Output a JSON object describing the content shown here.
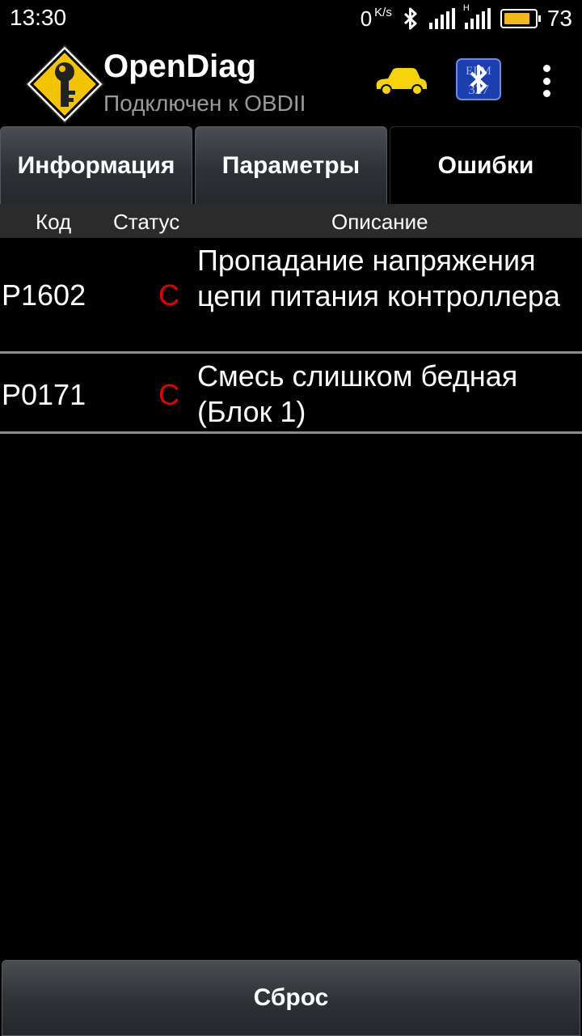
{
  "status_bar": {
    "time": "13:30",
    "net_speed_value": "0",
    "net_speed_unit": "K/s",
    "network_type_label": "H",
    "battery_percent": "73",
    "battery_level": 0.73,
    "battery_color": "#f3b81a"
  },
  "app": {
    "title": "OpenDiag",
    "subtitle": "Подключен к OBDII",
    "icons": [
      "key-icon",
      "car-icon",
      "bluetooth-adapter-icon",
      "overflow-menu-icon"
    ],
    "adapter_icon_text": "ELM 327"
  },
  "tabs": [
    {
      "label": "Информация",
      "active": false
    },
    {
      "label": "Параметры",
      "active": false
    },
    {
      "label": "Ошибки",
      "active": true
    }
  ],
  "table": {
    "headers": {
      "code": "Код",
      "status": "Статус",
      "description": "Описание"
    },
    "rows": [
      {
        "code": "P1602",
        "status": "C",
        "description": "Пропадание напряжения цепи питания контроллера"
      },
      {
        "code": "P0171",
        "status": "C",
        "description": "Смесь слишком бедная (Блок 1)"
      }
    ],
    "status_color": "#e00000"
  },
  "reset_button": {
    "label": "Сброс"
  }
}
